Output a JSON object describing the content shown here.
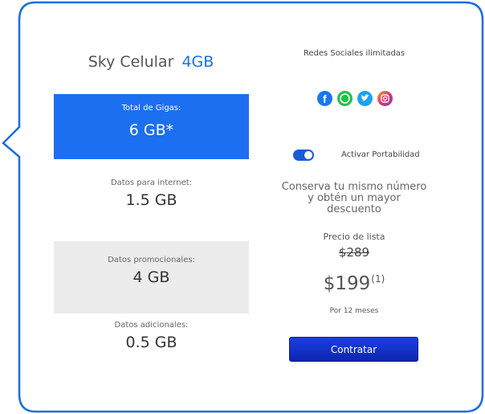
{
  "plan": {
    "name": "Sky Celular",
    "size": "4GB"
  },
  "gigas": {
    "total_label": "Total de Gigas:",
    "total_value": "6 GB*",
    "internet_label": "Datos para internet:",
    "internet_value": "1.5 GB",
    "promo_label": "Datos promocionales:",
    "promo_value": "4 GB",
    "additional_label": "Datos adicionales:",
    "additional_value": "0.5 GB"
  },
  "social": {
    "title": "Redes Sociales ilimitadas",
    "icons": [
      "facebook-icon",
      "whatsapp-icon",
      "twitter-icon",
      "instagram-icon"
    ]
  },
  "portability": {
    "toggle_label": "Activar Portabilidad",
    "enabled": true,
    "description": "Conserva tu mismo número y obtén un mayor descuento"
  },
  "pricing": {
    "list_label": "Precio de lista",
    "list_price": "$289",
    "price": "$199",
    "price_note": "(1)",
    "period": "Por 12 meses"
  },
  "cta": {
    "label": "Contratar"
  },
  "colors": {
    "accent": "#1573e6",
    "total_box": "#1c6ff0",
    "promo_box": "#ececec",
    "button": "#1b3fe0",
    "card_border": "#1a6ee0"
  }
}
